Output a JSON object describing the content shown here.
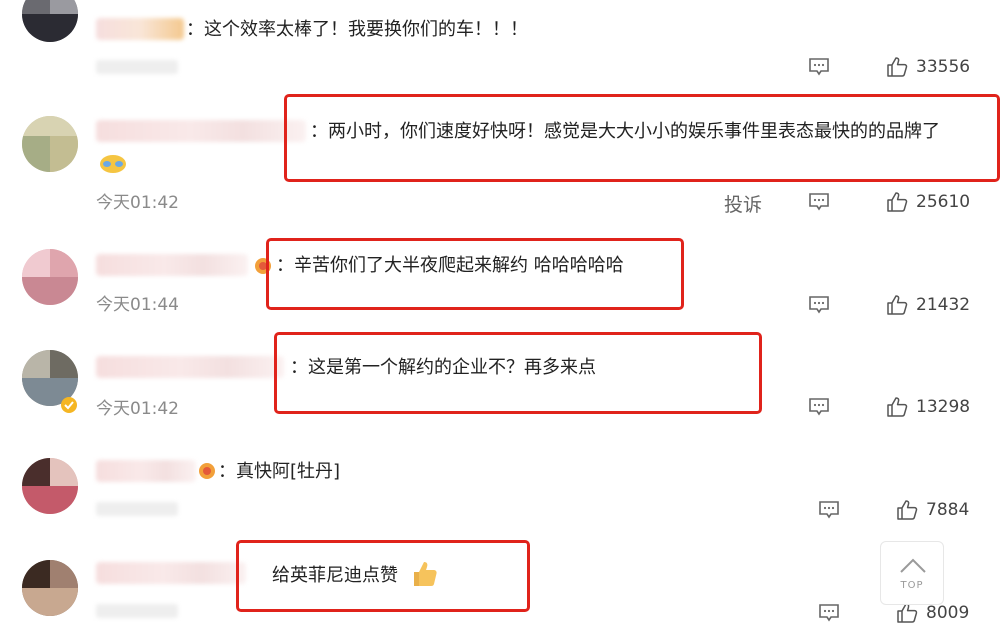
{
  "colors": {
    "highlight": "#e0231b",
    "time": "#8a8a8a",
    "count": "#444444"
  },
  "comments": [
    {
      "text": "：这个效率太棒了！我要换你们的车！！！",
      "likes": "33556",
      "time": ""
    },
    {
      "text": "：两小时，你们速度好快呀！感觉是大大小小的娱乐事件里表态最快的的品牌了",
      "likes": "25610",
      "time": "今天01:42",
      "report": "投诉"
    },
    {
      "text": "：辛苦你们了大半夜爬起来解约 哈哈哈哈哈",
      "likes": "21432",
      "time": "今天01:44"
    },
    {
      "text": "：这是第一个解约的企业不？再多来点",
      "likes": "13298",
      "time": "今天01:42"
    },
    {
      "text": "：真快阿[牡丹]",
      "likes": "7884",
      "time": ""
    },
    {
      "text": "给英菲尼迪点赞",
      "likes": "8009",
      "time": ""
    }
  ],
  "icons": {
    "comment": "comment-icon",
    "like": "thumbs-up-icon",
    "scroll_top": "chevron-up-icon",
    "thumbs_emoji": "thumbs-up-emoji"
  },
  "scroll_top": {
    "label": "TOP"
  }
}
